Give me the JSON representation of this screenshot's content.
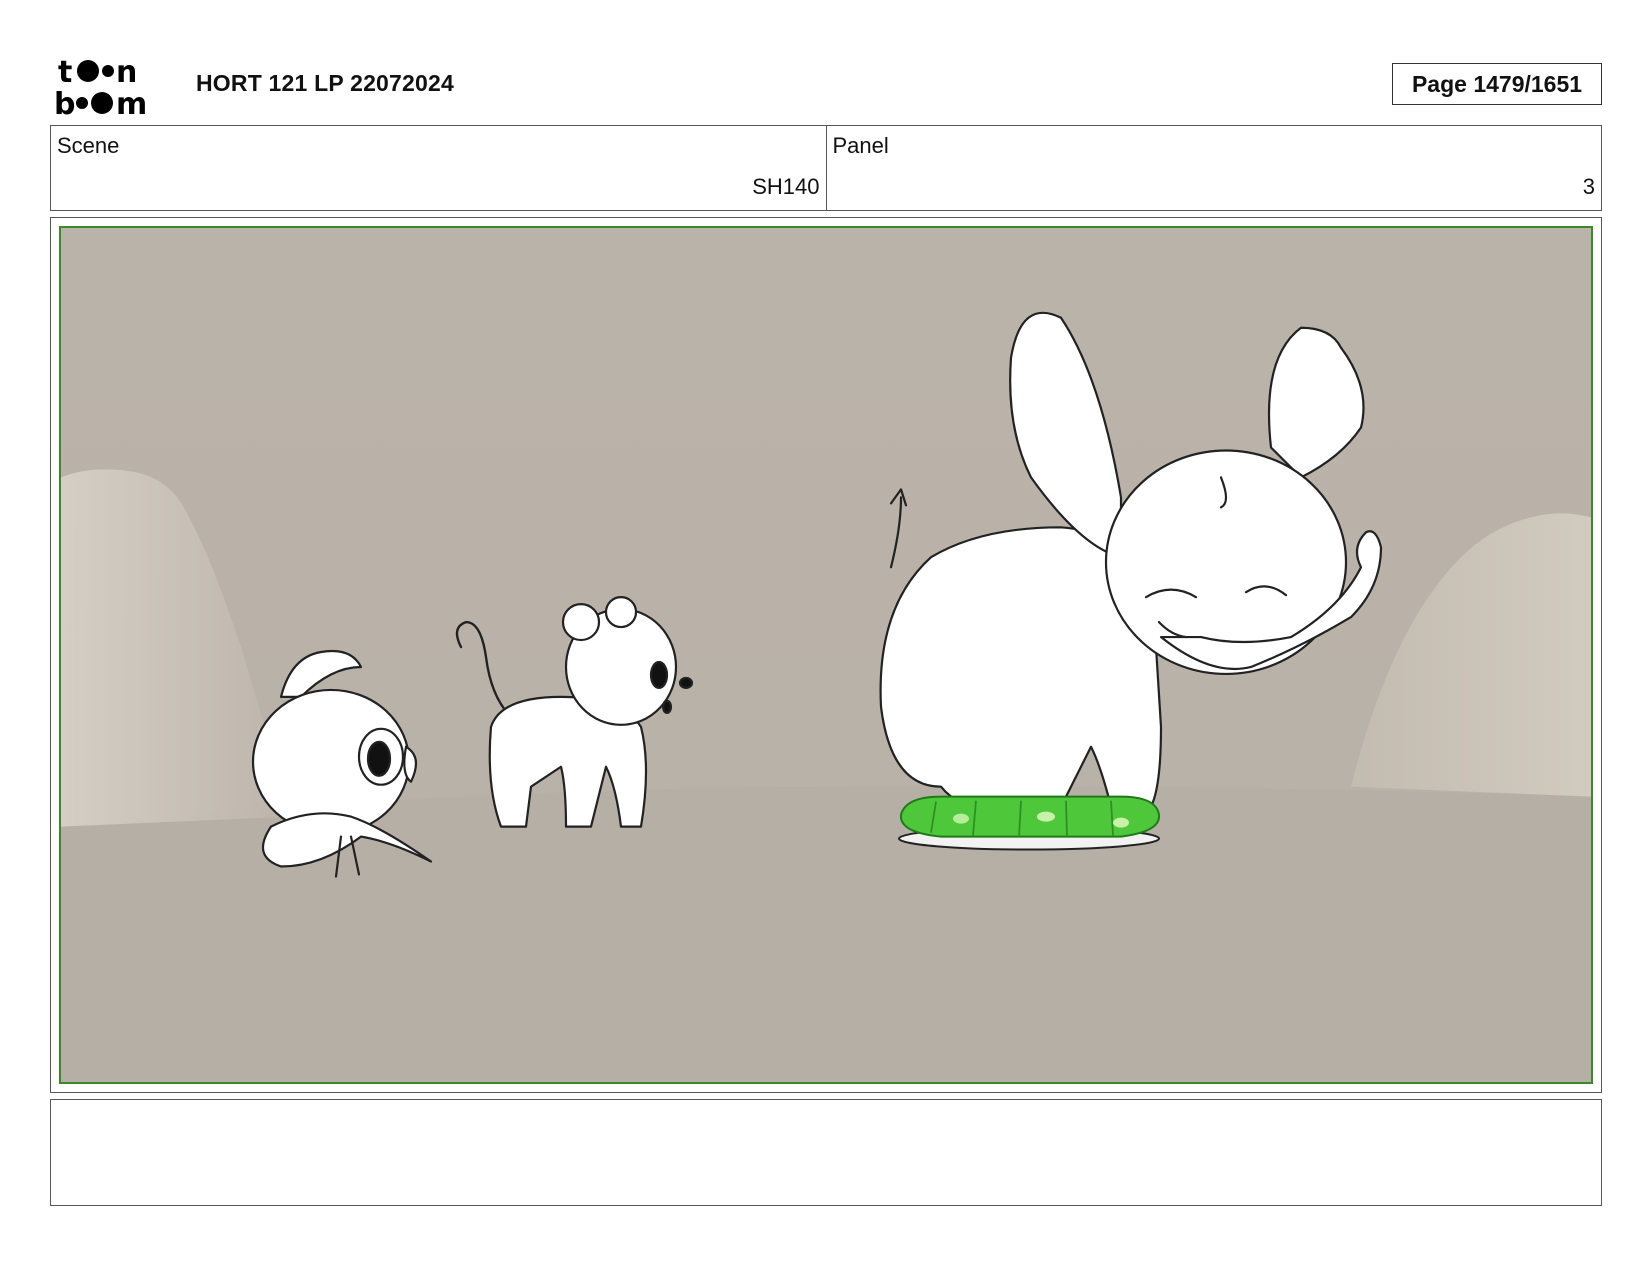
{
  "header": {
    "logo_text": "toonboom",
    "title": "HORT 121 LP 22072024",
    "page": "Page 1479/1651"
  },
  "info": {
    "scene_label": "Scene",
    "scene_value": "SH140",
    "panel_label": "Panel",
    "panel_value": "3"
  },
  "panel": {
    "frame_color": "#3a8a2a",
    "background_color": "#bbb4ab"
  },
  "notes": {
    "text": ""
  }
}
